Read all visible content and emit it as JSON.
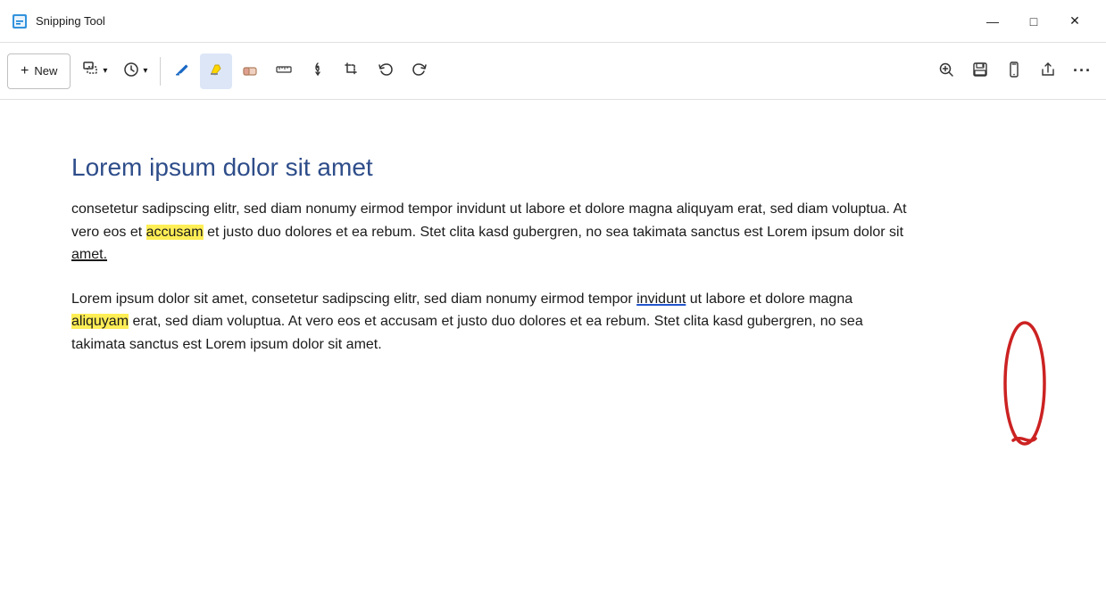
{
  "titleBar": {
    "appName": "Snipping Tool",
    "minimize": "—",
    "maximize": "□",
    "close": "✕"
  },
  "toolbar": {
    "newLabel": "New",
    "tools": [
      {
        "name": "selection-mode",
        "icon": "⬜",
        "hasDropdown": true
      },
      {
        "name": "delay-mode",
        "icon": "🕐",
        "hasDropdown": true
      },
      {
        "name": "pen-tool",
        "icon": "✏️",
        "active": false
      },
      {
        "name": "highlighter-tool",
        "icon": "🖊",
        "active": true
      },
      {
        "name": "eraser-tool",
        "icon": "◇",
        "active": false
      },
      {
        "name": "ruler-tool",
        "icon": "📏",
        "active": false
      },
      {
        "name": "touch-write",
        "icon": "✋",
        "active": false
      },
      {
        "name": "crop-tool",
        "icon": "⬚",
        "active": false
      },
      {
        "name": "undo",
        "icon": "↩",
        "active": false
      },
      {
        "name": "redo",
        "icon": "↪",
        "active": false
      }
    ],
    "rightTools": [
      {
        "name": "zoom-in",
        "icon": "🔍"
      },
      {
        "name": "save",
        "icon": "💾"
      },
      {
        "name": "phone",
        "icon": "📱"
      },
      {
        "name": "share",
        "icon": "↗"
      },
      {
        "name": "more",
        "icon": "⋯"
      }
    ]
  },
  "document": {
    "title": "Lorem ipsum dolor sit amet",
    "para1": {
      "text": "consetetur sadipscing elitr, sed diam nonumy eirmod tempor invidunt ut labore et dolore magna aliquyam erat, sed diam voluptua. At vero eos et ",
      "highlighted": "accusam",
      "text2": " et justo duo dolores et ea rebum. Stet clita kasd gubergren, no sea takimata sanctus est Lorem ipsum dolor sit ",
      "underlined": "amet.",
      "text3": ""
    },
    "para2": {
      "text": "Lorem ipsum dolor sit amet, consetetur sadipscing elitr, sed diam nonumy eirmod tempor ",
      "underlined": "invidunt",
      "text2": " ut labore et dolore magna ",
      "highlighted": "aliquyam",
      "text3": " erat, sed diam voluptua. At vero eos et accusam et justo duo dolores et ea rebum. Stet clita kasd gubergren, no sea takimata sanctus est Lorem ipsum dolor sit amet."
    }
  }
}
